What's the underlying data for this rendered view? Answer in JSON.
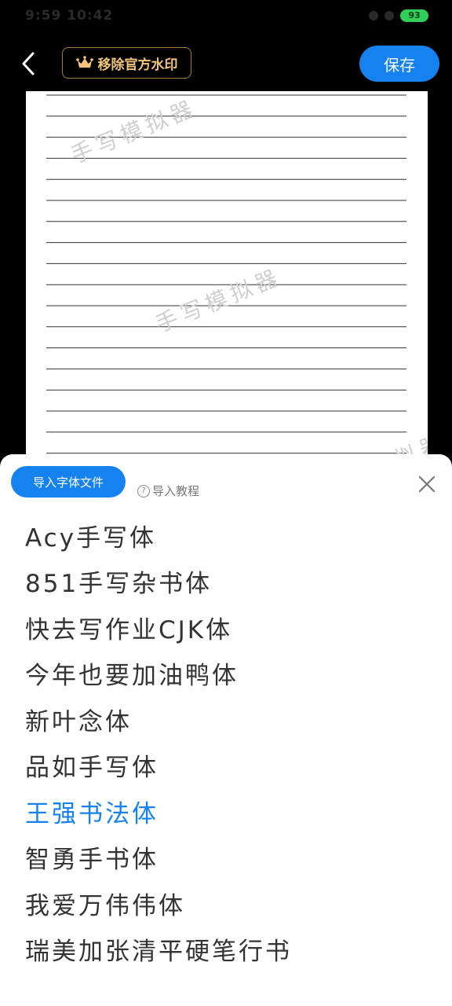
{
  "status": {
    "time": "9:59 10:42",
    "battery": "93"
  },
  "header": {
    "back_icon": "chevron-left-icon",
    "watermark_label": "移除官方水印",
    "crown_icon": "crown-icon",
    "save_label": "保存"
  },
  "paper": {
    "watermark_text": "手写模拟器",
    "line_count": 18
  },
  "sheet": {
    "import_label": "导入字体文件",
    "tutorial_label": "导入教程",
    "close_icon": "close-icon",
    "fonts": [
      "Acy手写体",
      "851手写杂书体",
      "快去写作业CJK体",
      "今年也要加油鸭体",
      "新叶念体",
      "品如手写体",
      "王强书法体",
      "智勇手书体",
      "我爱万伟伟体",
      "瑞美加张清平硬笔行书"
    ],
    "selected_font": "王强书法体"
  },
  "colors": {
    "accent": "#1582f0",
    "gold": "#f2c57f"
  }
}
